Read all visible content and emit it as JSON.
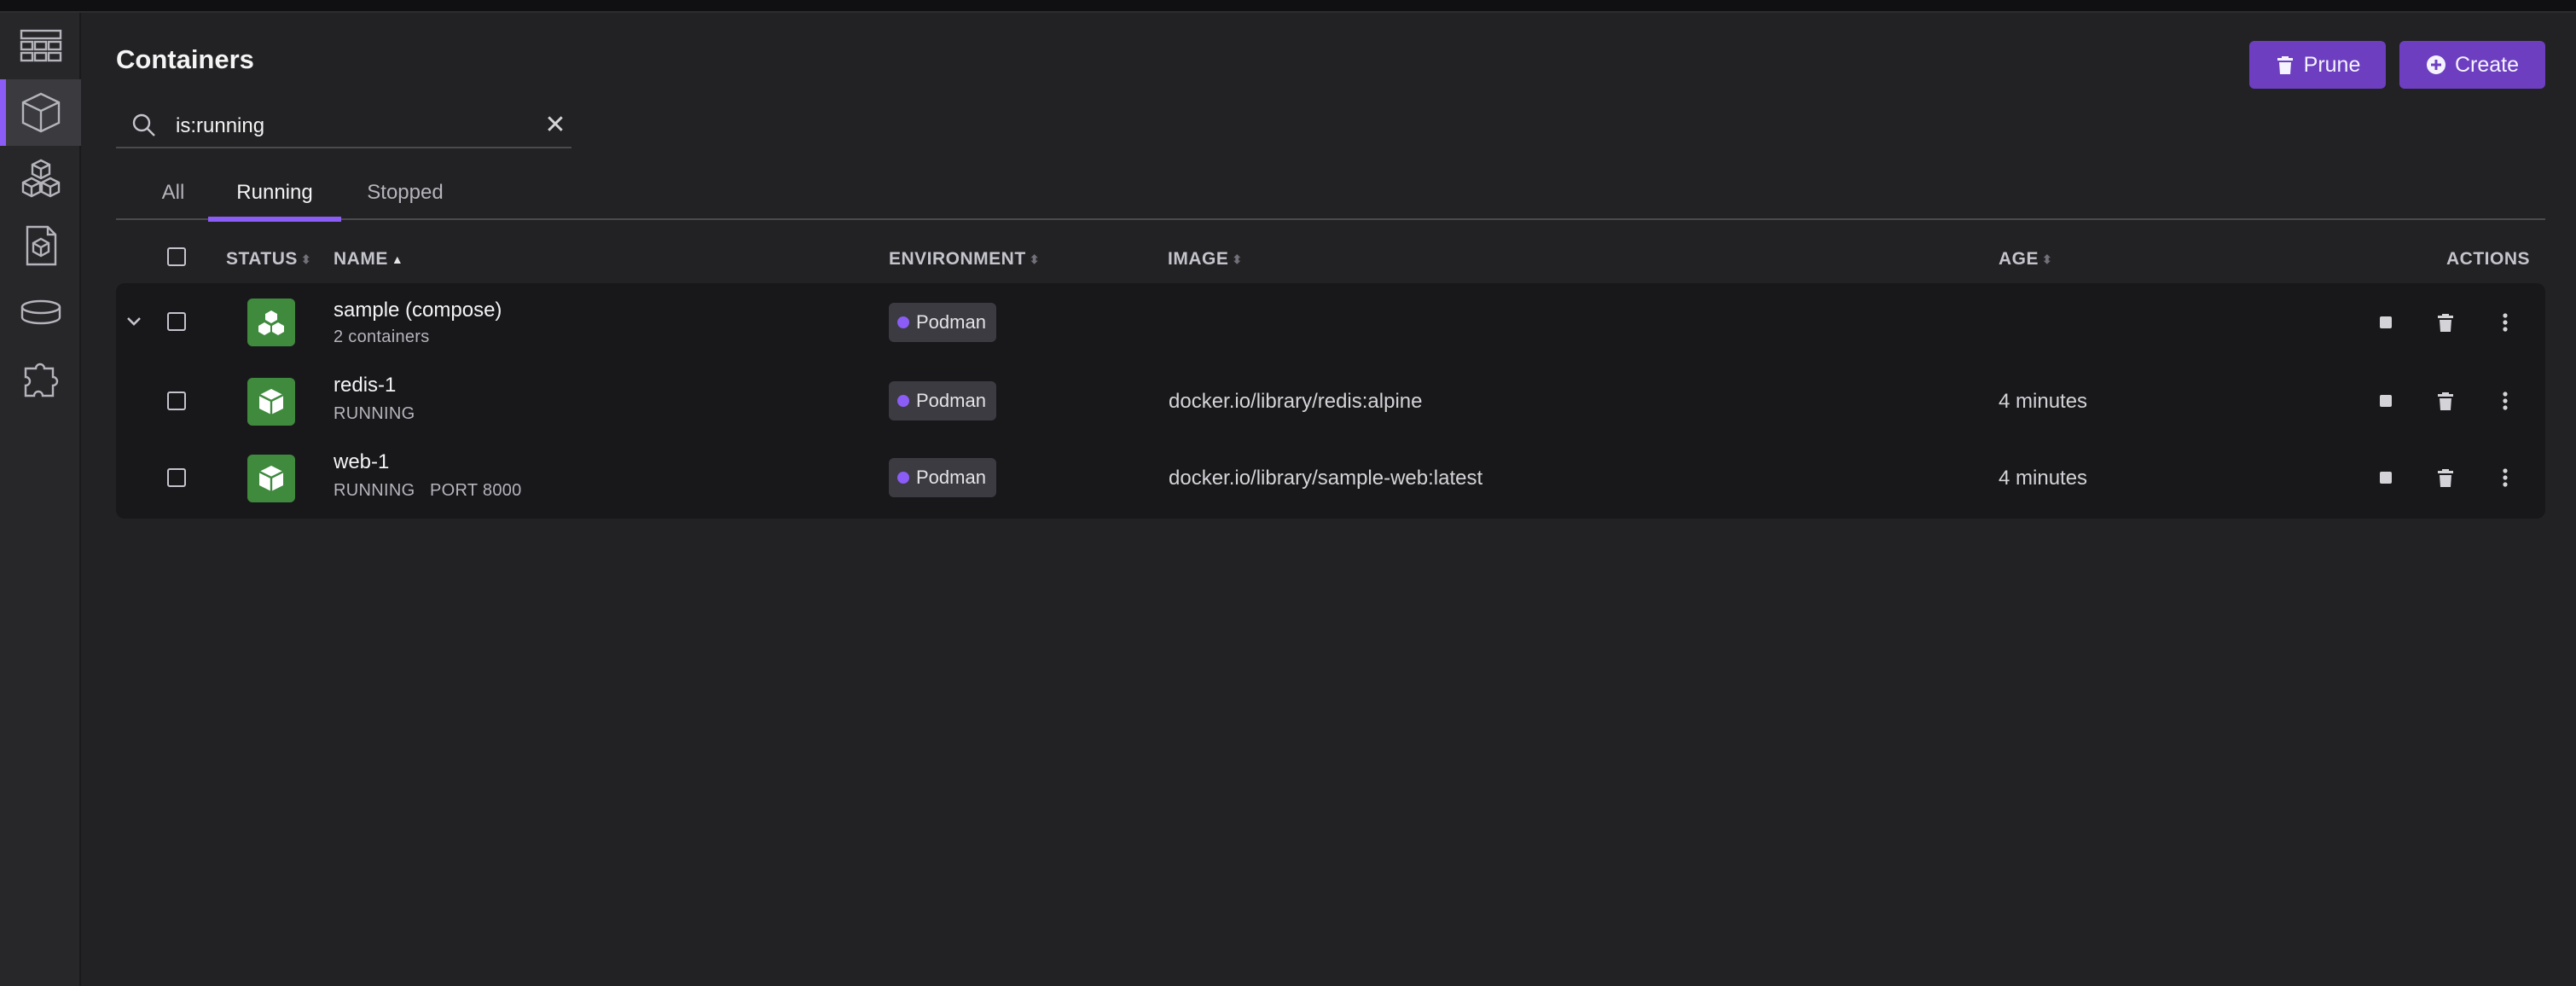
{
  "nav": {
    "items": [
      {
        "name": "dashboard",
        "icon": "dashboard-icon",
        "active": false
      },
      {
        "name": "containers",
        "icon": "container-cube-icon",
        "active": true
      },
      {
        "name": "pods",
        "icon": "pods-cubes-icon",
        "active": false
      },
      {
        "name": "images",
        "icon": "image-file-icon",
        "active": false
      },
      {
        "name": "volumes",
        "icon": "volume-cylinder-icon",
        "active": false
      },
      {
        "name": "extensions",
        "icon": "puzzle-icon",
        "active": false
      }
    ]
  },
  "header": {
    "title": "Containers",
    "prune_label": "Prune",
    "create_label": "Create"
  },
  "search": {
    "value": "is:running",
    "clear_glyph": "✕"
  },
  "tabs": [
    {
      "label": "All",
      "active": false
    },
    {
      "label": "Running",
      "active": true
    },
    {
      "label": "Stopped",
      "active": false
    }
  ],
  "table": {
    "columns": {
      "status": "STATUS",
      "name": "NAME",
      "environment": "ENVIRONMENT",
      "image": "IMAGE",
      "age": "AGE",
      "actions": "ACTIONS"
    },
    "rows": [
      {
        "name": "sample (compose)",
        "sub": "2 containers",
        "environment": "Podman",
        "image": "",
        "age": "",
        "group": true
      },
      {
        "name": "redis-1",
        "sub": "RUNNING",
        "environment": "Podman",
        "image": "docker.io/library/redis:alpine",
        "age": "4 minutes",
        "group": false
      },
      {
        "name": "web-1",
        "sub": "RUNNING   PORT 8000",
        "environment": "Podman",
        "image": "docker.io/library/sample-web:latest",
        "age": "4 minutes",
        "group": false
      }
    ]
  },
  "colors": {
    "accent": "#8b5cf6",
    "button": "#6d3fc0",
    "status_running": "#3f8a3d",
    "background": "#222224"
  }
}
